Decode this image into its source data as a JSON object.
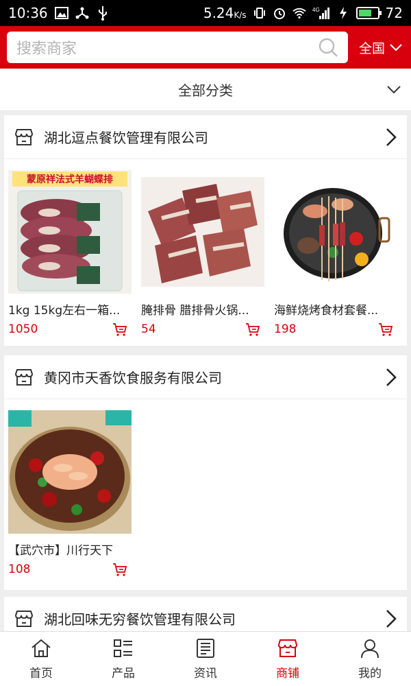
{
  "status_bar": {
    "time": "10:36",
    "speed": "5.24",
    "speed_unit": "K/s",
    "network": "4G",
    "battery": "72",
    "battery_level": 0.72
  },
  "search": {
    "placeholder": "搜索商家"
  },
  "region": {
    "label": "全国"
  },
  "category": {
    "label": "全部分类"
  },
  "shops": [
    {
      "name": "湖北逗点餐饮管理有限公司",
      "products": [
        {
          "name": "1kg 15kg左右一箱...",
          "price": "1050",
          "image_text": "蒙原祥法式羊蝴蝶排"
        },
        {
          "name": "腌排骨 腊排骨火锅...",
          "price": "54"
        },
        {
          "name": "海鲜烧烤食材套餐...",
          "price": "198"
        }
      ]
    },
    {
      "name": "黄冈市天香饮食服务有限公司",
      "products": [
        {
          "name": "【武穴市】川行天下",
          "price": "108"
        }
      ]
    },
    {
      "name": "湖北回味无穷餐饮管理有限公司",
      "products": []
    }
  ],
  "tabs": [
    {
      "label": "首页",
      "icon": "home-icon"
    },
    {
      "label": "产品",
      "icon": "grid-list-icon"
    },
    {
      "label": "资讯",
      "icon": "news-icon"
    },
    {
      "label": "商铺",
      "icon": "store-icon",
      "active": true
    },
    {
      "label": "我的",
      "icon": "user-icon"
    }
  ],
  "colors": {
    "brand_red": "#d8000c",
    "price_red": "#d8000c",
    "status_bar": "#000000"
  }
}
